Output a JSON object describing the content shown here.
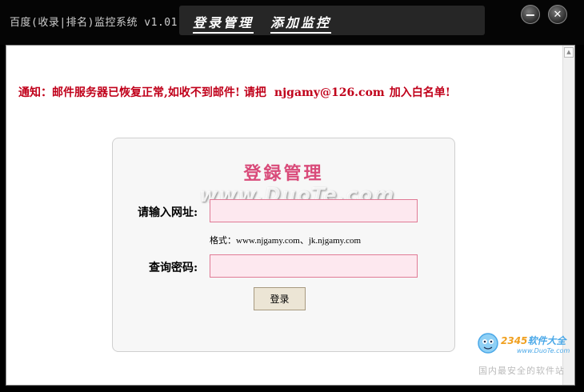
{
  "app": {
    "title": "百度(收录|排名)监控系统 v1.01"
  },
  "nav": {
    "tabs": [
      {
        "label": "登录管理"
      },
      {
        "label": "添加监控"
      }
    ]
  },
  "window": {
    "minimize_glyph": "−",
    "close_glyph": "✕"
  },
  "notice": {
    "prefix": "通知：邮件服务器已恢复正常,如收不到邮件! 请把",
    "email": "njgamy@126.com",
    "suffix": "加入白名单!",
    "color": "#c0001a"
  },
  "login": {
    "title": "登録管理",
    "url_label": "请输入网址:",
    "url_value": "",
    "format_hint": "格式：www.njgamy.com、jk.njgamy.com",
    "password_label": "查询密码:",
    "password_value": "",
    "submit_label": "登录",
    "accent": "#d94b7a"
  },
  "watermark": {
    "text": "www.DuoTe.com"
  },
  "site_mark": {
    "brand_prefix": "2345",
    "brand_suffix": "软件大全",
    "url": "www.DuoTe.com",
    "slogan": "国内最安全的软件站"
  }
}
